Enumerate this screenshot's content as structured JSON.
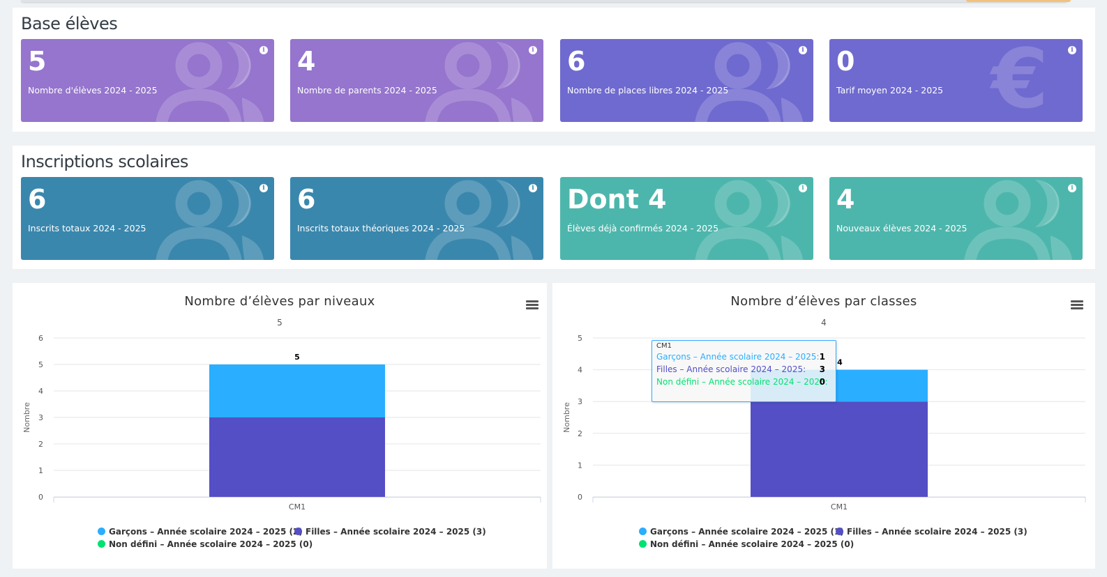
{
  "sections": {
    "base": {
      "title": "Base élèves",
      "cards": [
        {
          "value": "5",
          "label": "Nombre d'élèves 2024 - 2025",
          "color": "#9575cd",
          "icon": "users-icon"
        },
        {
          "value": "4",
          "label": "Nombre de parents 2024 - 2025",
          "color": "#9575cd",
          "icon": "users-icon"
        },
        {
          "value": "6",
          "label": "Nombre de places libres 2024 - 2025",
          "color": "#6f6acf",
          "icon": "users-icon"
        },
        {
          "value": "0",
          "label": "Tarif moyen 2024 - 2025",
          "color": "#6f6acf",
          "icon": "euro-icon"
        }
      ]
    },
    "inscriptions": {
      "title": "Inscriptions scolaires",
      "cards": [
        {
          "value": "6",
          "label": "Inscrits totaux 2024 - 2025",
          "color": "#3a87ad",
          "icon": "users-icon"
        },
        {
          "value": "6",
          "label": "Inscrits totaux théoriques 2024 - 2025",
          "color": "#3a87ad",
          "icon": "users-icon"
        },
        {
          "value": "Dont 4",
          "label": "Élèves déjà confirmés 2024 - 2025",
          "color": "#4db6ac",
          "icon": "users-icon"
        },
        {
          "value": "4",
          "label": "Nouveaux élèves 2024 - 2025",
          "color": "#4db6ac",
          "icon": "users-icon"
        }
      ]
    }
  },
  "colors": {
    "garcons": "#2aaeff",
    "filles": "#544fc5",
    "nondefini": "#00e272"
  },
  "chart_data": [
    {
      "type": "bar",
      "stacked": true,
      "title": "Nombre d’élèves par niveaux",
      "subtitle": "5",
      "ylabel": "Nombre",
      "categories": [
        "CM1"
      ],
      "ylim": [
        0,
        6
      ],
      "yticks": [
        "0",
        "1",
        "2",
        "3",
        "4",
        "5",
        "6"
      ],
      "total_labels": [
        "5"
      ],
      "series": [
        {
          "name": "Filles – Année scolaire 2024 – 2025",
          "values": [
            3
          ]
        },
        {
          "name": "Garçons – Année scolaire 2024 – 2025",
          "values": [
            2
          ]
        },
        {
          "name": "Non défini – Année scolaire 2024 – 2025",
          "values": [
            0
          ]
        }
      ],
      "legend": [
        "Garçons – Année scolaire 2024 – 2025 (2)",
        "Filles – Année scolaire 2024 – 2025 (3)",
        "Non défini – Année scolaire 2024 – 2025 (0)"
      ]
    },
    {
      "type": "bar",
      "stacked": true,
      "title": "Nombre d’élèves par classes",
      "subtitle": "4",
      "ylabel": "Nombre",
      "categories": [
        "CM1"
      ],
      "ylim": [
        0,
        5
      ],
      "yticks": [
        "0",
        "1",
        "2",
        "3",
        "4",
        "5"
      ],
      "total_labels": [
        "4"
      ],
      "series": [
        {
          "name": "Filles – Année scolaire 2024 – 2025",
          "values": [
            3
          ]
        },
        {
          "name": "Garçons – Année scolaire 2024 – 2025",
          "values": [
            1
          ]
        },
        {
          "name": "Non défini – Année scolaire 2024 – 2025",
          "values": [
            0
          ]
        }
      ],
      "legend": [
        "Garçons – Année scolaire 2024 – 2025 (1)",
        "Filles – Année scolaire 2024 – 2025 (3)",
        "Non défini – Année scolaire 2024 – 2025 (0)"
      ],
      "tooltip": {
        "header": "CM1",
        "rows": [
          {
            "label": "Garçons – Année scolaire 2024 – 2025:",
            "value": "1"
          },
          {
            "label": "Filles – Année scolaire 2024 – 2025:",
            "value": "3"
          },
          {
            "label": "Non défini – Année scolaire 2024 – 2025:",
            "value": "0"
          }
        ]
      }
    }
  ]
}
